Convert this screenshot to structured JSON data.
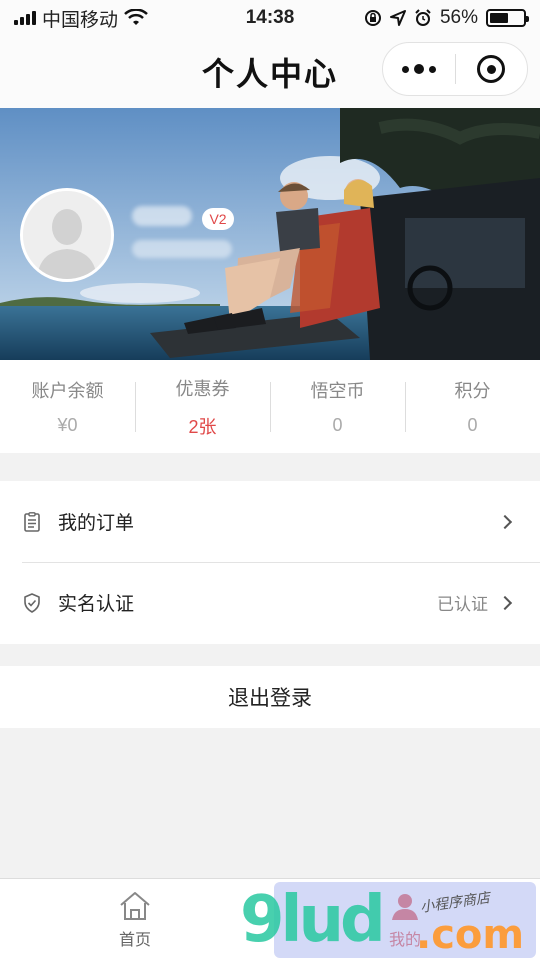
{
  "status_bar": {
    "carrier": "中国移动",
    "time": "14:38",
    "battery": "56%",
    "battery_level": 0.56,
    "icons": [
      "signal-icon",
      "wifi-icon",
      "rotation-lock-icon",
      "location-icon",
      "alarm-icon",
      "battery-icon"
    ]
  },
  "nav": {
    "title": "个人中心",
    "capsule_icons": [
      "more-icon",
      "close-target-icon"
    ]
  },
  "profile": {
    "badge": "V2",
    "avatar_icon": "default-avatar-icon"
  },
  "stats": [
    {
      "label": "账户余额",
      "value": "¥0",
      "highlight": false
    },
    {
      "label": "优惠券",
      "value": "2张",
      "highlight": true
    },
    {
      "label": "悟空币",
      "value": "0",
      "highlight": false
    },
    {
      "label": "积分",
      "value": "0",
      "highlight": false
    }
  ],
  "menu": [
    {
      "label": "我的订单",
      "status": "",
      "icon": "order-list-icon"
    },
    {
      "label": "实名认证",
      "status": "已认证",
      "icon": "shield-check-icon"
    }
  ],
  "logout_label": "退出登录",
  "tabbar": [
    {
      "label": "首页",
      "icon": "home-icon",
      "active": false
    },
    {
      "label": "我的",
      "icon": "user-icon",
      "active": true
    }
  ],
  "watermark": {
    "text_main": "9lud",
    "text_com": ".com",
    "text_small": "小程序商店"
  },
  "colors": {
    "accent": "#e04848",
    "muted": "#888888",
    "background": "#f2f2f2"
  }
}
